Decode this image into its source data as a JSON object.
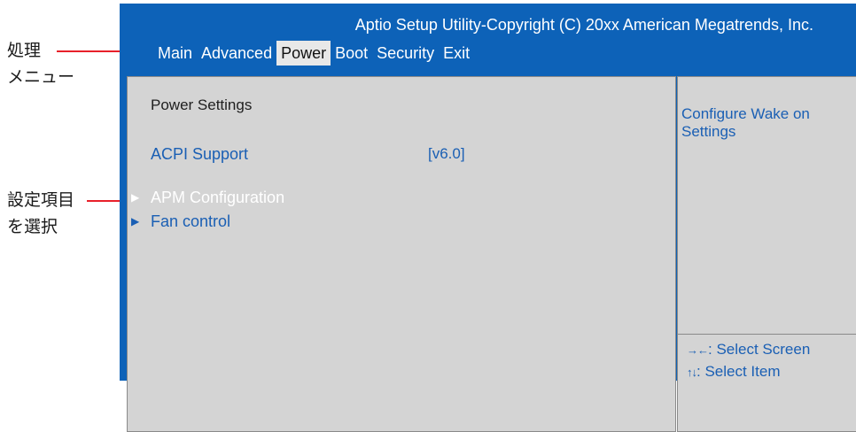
{
  "annotations": {
    "menu_label": [
      "処理",
      "メニュー"
    ],
    "select_label": [
      "設定項目",
      "を選択"
    ]
  },
  "bios": {
    "title": "Aptio Setup Utility-Copyright (C) 20xx American Megatrends, Inc.",
    "menu": [
      {
        "label": "Main",
        "active": false
      },
      {
        "label": "Advanced",
        "active": false
      },
      {
        "label": "Power",
        "active": true
      },
      {
        "label": "Boot",
        "active": false
      },
      {
        "label": "Security",
        "active": false
      },
      {
        "label": "Exit",
        "active": false
      }
    ],
    "section_title": "Power  Settings",
    "settings": [
      {
        "label": "ACPI Support",
        "value": "[v6.0]"
      }
    ],
    "submenus": [
      {
        "label": "APM Configuration",
        "selected": true
      },
      {
        "label": "Fan control",
        "selected": false
      }
    ],
    "help_lines": [
      "Configure  Wake on",
      "Settings"
    ],
    "hints": [
      {
        "keys": "→←",
        "text": ": Select Screen"
      },
      {
        "keys": "↑↓",
        "text": ": Select Item"
      }
    ]
  },
  "colors": {
    "header_bg": "#0d62b8",
    "panel_bg": "#d4d4d4",
    "text_blue": "#1a5fb4",
    "active_tab_bg": "#e8e8e8",
    "pointer_red": "#e8202a"
  }
}
